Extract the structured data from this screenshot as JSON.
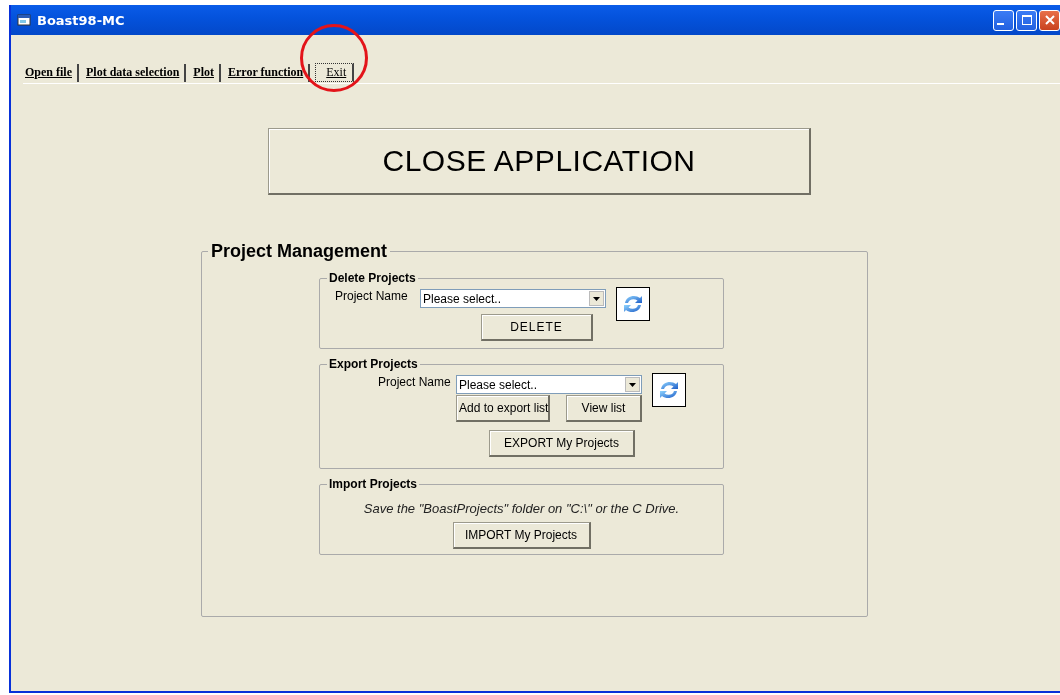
{
  "window": {
    "title": "Boast98-MC"
  },
  "tabs": [
    {
      "label": "Open file",
      "selected": false
    },
    {
      "label": "Plot data selection",
      "selected": false
    },
    {
      "label": "Plot",
      "selected": false
    },
    {
      "label": "Error function",
      "selected": false
    },
    {
      "label": "Exit",
      "selected": true
    }
  ],
  "close_button": {
    "label": "CLOSE APPLICATION"
  },
  "project_management": {
    "title": "Project Management",
    "delete_projects": {
      "title": "Delete Projects",
      "field_label": "Project Name",
      "dropdown": {
        "value": "Please select.."
      },
      "buttons": [
        "DELETE"
      ]
    },
    "export_projects": {
      "title": "Export Projects",
      "field_label": "Project Name",
      "dropdown": {
        "value": "Please select.."
      },
      "buttons": [
        "Add to export list",
        "View list",
        "EXPORT My Projects"
      ]
    },
    "import_projects": {
      "title": "Import Projects",
      "note": "Save the \"BoastProjects\" folder on \"C:\\\" or the C Drive.",
      "buttons": [
        "IMPORT My Projects"
      ]
    }
  }
}
